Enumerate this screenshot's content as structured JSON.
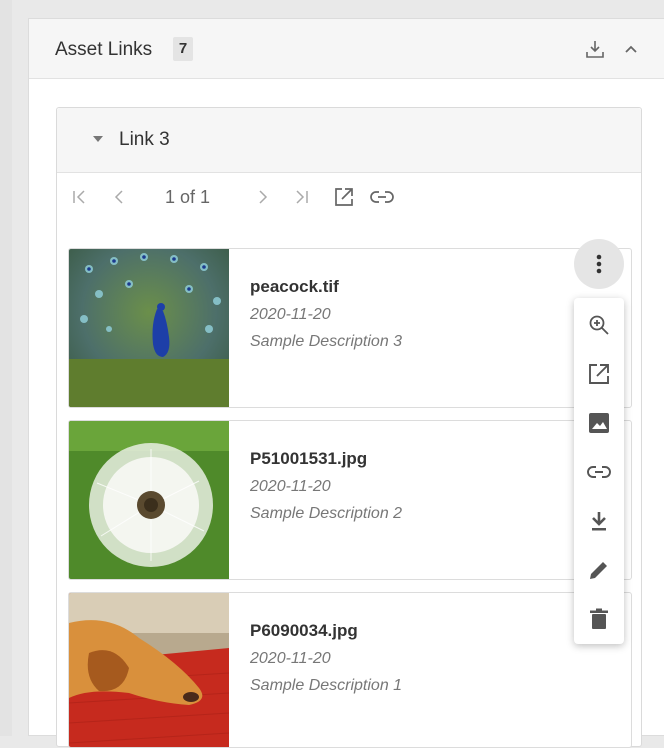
{
  "panel": {
    "title": "Asset Links",
    "count": "7",
    "icons": [
      "download-icon",
      "chevron-up-icon"
    ]
  },
  "link": {
    "title": "Link 3",
    "pager": {
      "text": "1 of 1",
      "icons": [
        "first-page-icon",
        "prev-page-icon",
        "next-page-icon",
        "last-page-icon",
        "open-external-icon",
        "link-icon"
      ]
    }
  },
  "assets": [
    {
      "filename": "peacock.tif",
      "date": "2020-11-20",
      "description": "Sample Description 3",
      "thumbnail": "peacock"
    },
    {
      "filename": "P51001531.jpg",
      "date": "2020-11-20",
      "description": "Sample Description 2",
      "thumbnail": "dandelion"
    },
    {
      "filename": "P6090034.jpg",
      "date": "2020-11-20",
      "description": "Sample Description 1",
      "thumbnail": "sleeping-dog"
    }
  ],
  "context_menu": {
    "items": [
      "zoom-in-icon",
      "open-external-icon",
      "image-icon",
      "link-icon",
      "download-icon",
      "edit-icon",
      "delete-icon"
    ]
  },
  "colors": {
    "header_bg": "#f6f6f6",
    "icon_gray": "#666666",
    "badge_bg": "#e4e4e4"
  }
}
